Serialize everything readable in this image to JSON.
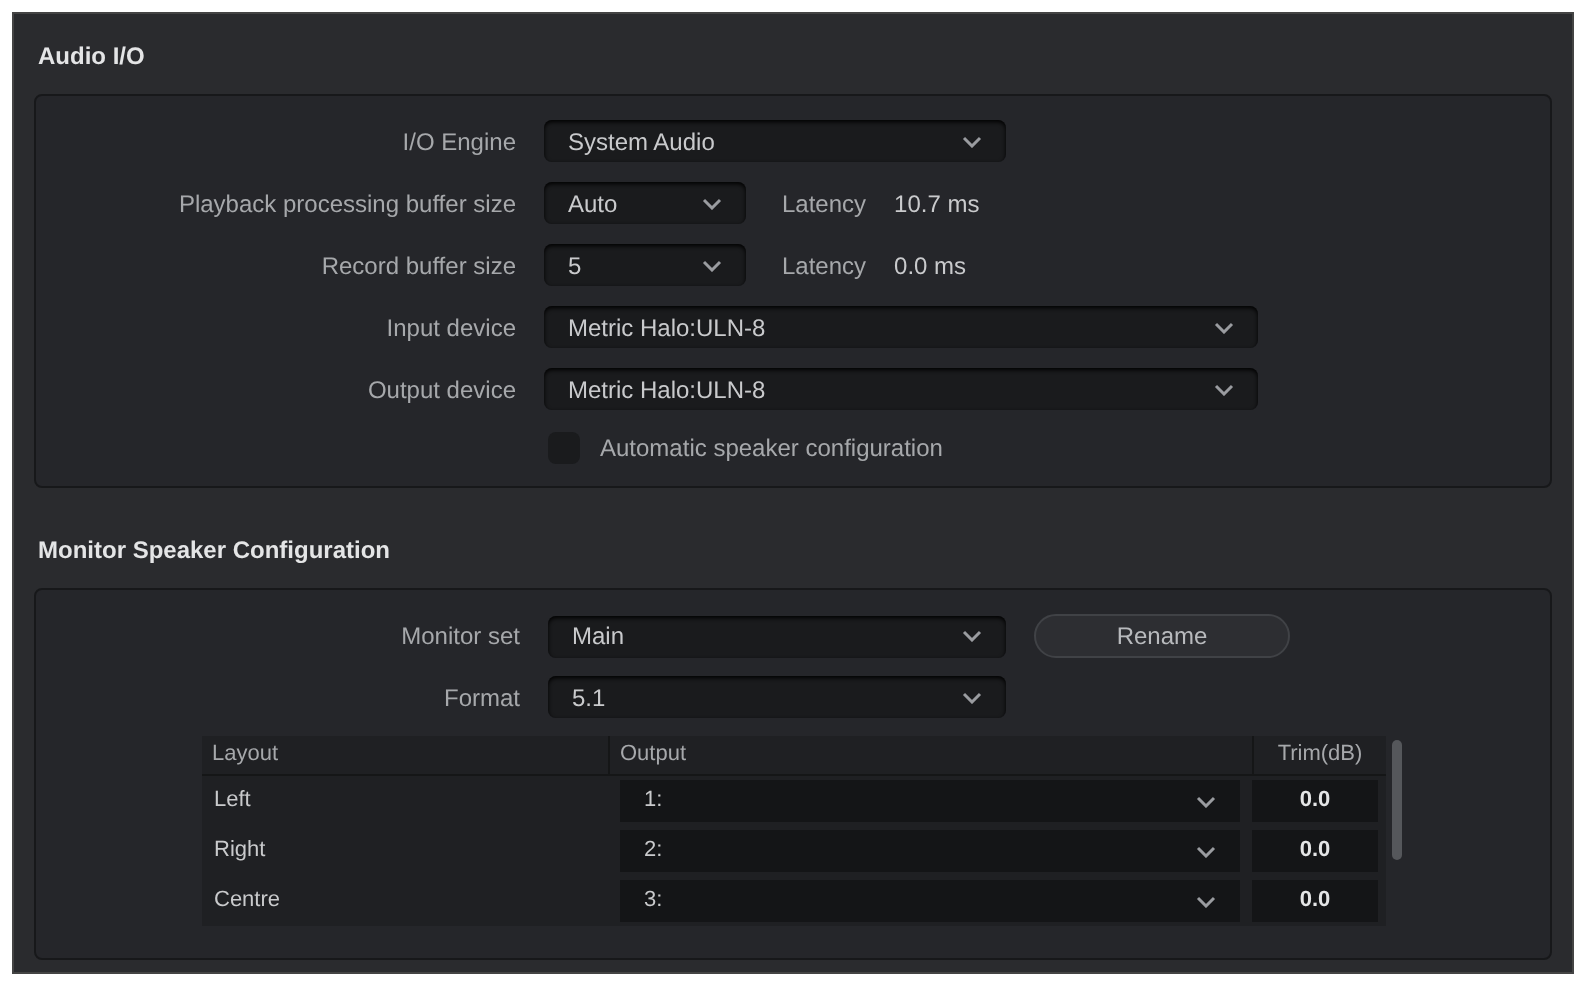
{
  "audio_io": {
    "title": "Audio I/O",
    "io_engine": {
      "label": "I/O Engine",
      "value": "System Audio"
    },
    "playback_buffer": {
      "label": "Playback processing buffer size",
      "value": "Auto",
      "latency_label": "Latency",
      "latency": "10.7 ms"
    },
    "record_buffer": {
      "label": "Record buffer size",
      "value": "5",
      "latency_label": "Latency",
      "latency": "0.0 ms"
    },
    "input_device": {
      "label": "Input device",
      "value": "Metric Halo:ULN-8"
    },
    "output_device": {
      "label": "Output device",
      "value": "Metric Halo:ULN-8"
    },
    "auto_speaker": {
      "label": "Automatic speaker configuration",
      "checked": false
    }
  },
  "monitor": {
    "title": "Monitor Speaker Configuration",
    "monitor_set": {
      "label": "Monitor set",
      "value": "Main",
      "button": "Rename"
    },
    "format": {
      "label": "Format",
      "value": "5.1"
    },
    "table": {
      "columns": [
        "Layout",
        "Output",
        "Trim(dB)"
      ],
      "rows": [
        {
          "layout": "Left",
          "output": "1:",
          "trim": "0.0"
        },
        {
          "layout": "Right",
          "output": "2:",
          "trim": "0.0"
        },
        {
          "layout": "Centre",
          "output": "3:",
          "trim": "0.0"
        }
      ]
    }
  }
}
